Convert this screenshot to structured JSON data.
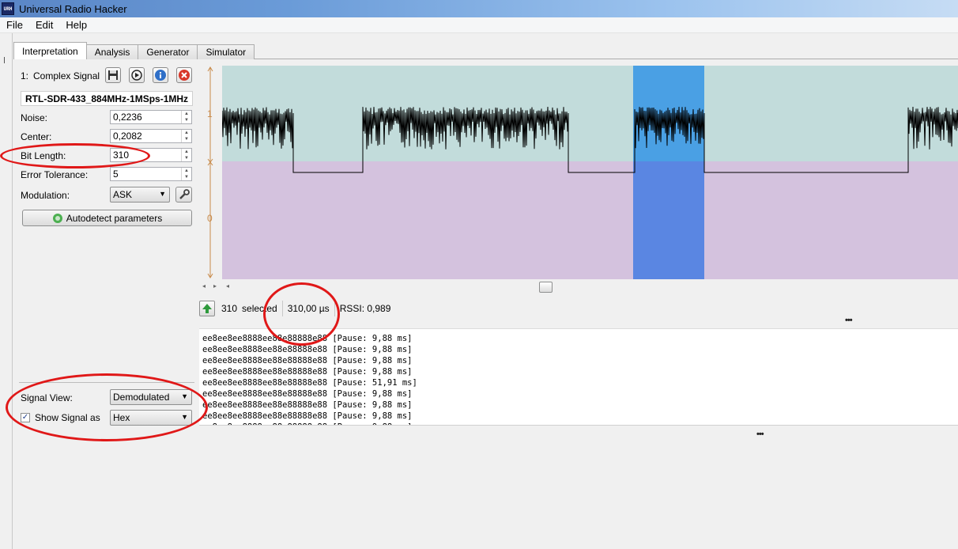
{
  "window": {
    "title": "Universal Radio Hacker",
    "icon_text": "URH"
  },
  "menu": [
    "File",
    "Edit",
    "Help"
  ],
  "tabs": [
    "Interpretation",
    "Analysis",
    "Generator",
    "Simulator"
  ],
  "signal": {
    "index_label": "1:",
    "type_label": "Complex Signal",
    "name": "RTL-SDR-433_884MHz-1MSps-1MHz"
  },
  "params": {
    "noise_label": "Noise:",
    "noise_value": "0,2236",
    "center_label": "Center:",
    "center_value": "0,2082",
    "bit_length_label": "Bit Length:",
    "bit_length_value": "310",
    "error_tolerance_label": "Error Tolerance:",
    "error_tolerance_value": "5",
    "modulation_label": "Modulation:",
    "modulation_value": "ASK",
    "autodetect_label": "Autodetect parameters"
  },
  "view": {
    "signal_view_label": "Signal View:",
    "signal_view_value": "Demodulated",
    "show_signal_as_label": "Show Signal as",
    "show_signal_as_value": "Hex",
    "show_signal_checked": true
  },
  "axis": {
    "top_label": "1",
    "bottom_label": "0"
  },
  "status": {
    "selected_count": "310",
    "selected_label": "selected",
    "duration": "310,00 µs",
    "rssi": "RSSI: 0,989"
  },
  "protocol_lines": [
    "ee8ee8ee8888ee88e88888e88 [Pause: 9,88 ms]",
    "ee8ee8ee8888ee88e88888e88 [Pause: 9,88 ms]",
    "ee8ee8ee8888ee88e88888e88 [Pause: 9,88 ms]",
    "ee8ee8ee8888ee88e88888e88 [Pause: 9,88 ms]",
    "ee8ee8ee8888ee88e88888e88 [Pause: 51,91 ms]",
    "ee8ee8ee8888ee88e88888e88 [Pause: 9,88 ms]",
    "ee8ee8ee8888ee88e88888e88 [Pause: 9,88 ms]",
    "ee8ee8ee8888ee88e88888e88 [Pause: 9,88 ms]"
  ],
  "colors": {
    "one_region": "#c2dcdb",
    "zero_region": "#d4c2de",
    "selection_upper": "#4aa0e4",
    "selection_lower": "#5a86e2",
    "annotation": "#e01818"
  }
}
